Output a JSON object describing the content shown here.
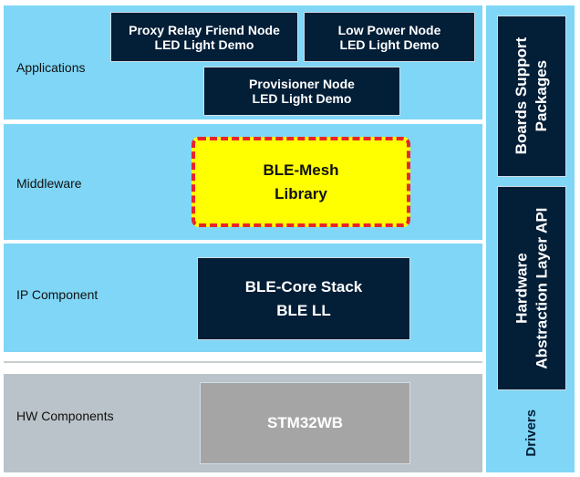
{
  "layers": {
    "applications": {
      "label": "Applications",
      "boxes": [
        {
          "line1": "Proxy Relay Friend Node",
          "line2": "LED Light Demo"
        },
        {
          "line1": "Low Power Node",
          "line2": "LED Light Demo"
        },
        {
          "line1": "Provisioner Node",
          "line2": "LED Light Demo"
        }
      ]
    },
    "middleware": {
      "label": "Middleware",
      "box": {
        "line1": "BLE-Mesh",
        "line2": "Library"
      }
    },
    "ip_component": {
      "label": "IP Component",
      "box": {
        "line1": "BLE-Core Stack",
        "line2": "BLE LL"
      }
    },
    "hw_components": {
      "label": "HW Components",
      "box": {
        "line1": "STM32WB"
      }
    }
  },
  "side": {
    "bsp": {
      "line1": "Boards Support",
      "line2": "Packages"
    },
    "hal": {
      "line1": "Hardware",
      "line2": "Abstraction Layer API"
    },
    "drivers": "Drivers"
  },
  "colors": {
    "layer": "#7fd6f6",
    "box": "#031e37",
    "highlight": "#ffff00",
    "highlight_border": "#e8242a",
    "hw_layer": "#b9c3c9",
    "hw_box": "#a5a5a5"
  }
}
